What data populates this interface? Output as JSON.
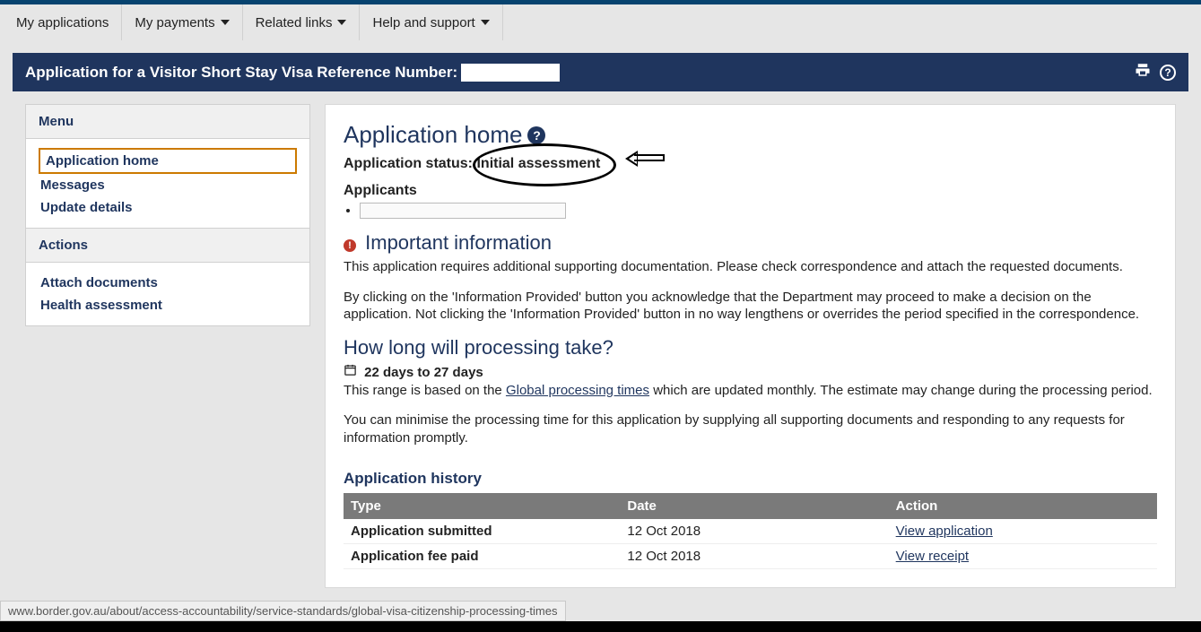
{
  "nav": {
    "items": [
      {
        "label": "My applications",
        "dropdown": false
      },
      {
        "label": "My payments",
        "dropdown": true
      },
      {
        "label": "Related links",
        "dropdown": true
      },
      {
        "label": "Help and support",
        "dropdown": true
      }
    ]
  },
  "header": {
    "title_prefix": "Application for a Visitor Short Stay Visa Reference Number:",
    "reference_value": ""
  },
  "sidebar": {
    "menu_heading": "Menu",
    "menu_items": [
      {
        "label": "Application home",
        "active": true
      },
      {
        "label": "Messages",
        "active": false
      },
      {
        "label": "Update details",
        "active": false
      }
    ],
    "actions_heading": "Actions",
    "action_items": [
      {
        "label": "Attach documents"
      },
      {
        "label": "Health assessment"
      }
    ]
  },
  "main": {
    "title": "Application home",
    "status_label": "Application status:",
    "status_value": "Initial assessment",
    "applicants_label": "Applicants",
    "applicant_value": "",
    "important_heading": "Important information",
    "important_p1": "This application requires additional supporting documentation. Please check correspondence and attach the requested documents.",
    "important_p2": "By clicking on the 'Information Provided' button you acknowledge that the Department may proceed to make a decision on the application. Not clicking the 'Information Provided' button in no way lengthens or overrides the period specified in the correspondence.",
    "processing_heading": "How long will processing take?",
    "processing_range": "22 days to 27 days",
    "processing_text_pre": "This range is based on the ",
    "processing_link": "Global processing times",
    "processing_text_post": " which are updated monthly. The estimate may change during the processing period.",
    "processing_p2": "You can minimise the processing time for this application by supplying all supporting documents and responding to any requests for information promptly.",
    "history_heading": "Application history",
    "history_cols": {
      "c1": "Type",
      "c2": "Date",
      "c3": "Action"
    },
    "history_rows": [
      {
        "type": "Application submitted",
        "date": "12 Oct 2018",
        "action": "View application"
      },
      {
        "type": "Application fee paid",
        "date": "12 Oct 2018",
        "action": "View receipt"
      }
    ]
  },
  "footer": {
    "status_url": "www.border.gov.au/about/access-accountability/service-standards/global-visa-citizenship-processing-times"
  }
}
